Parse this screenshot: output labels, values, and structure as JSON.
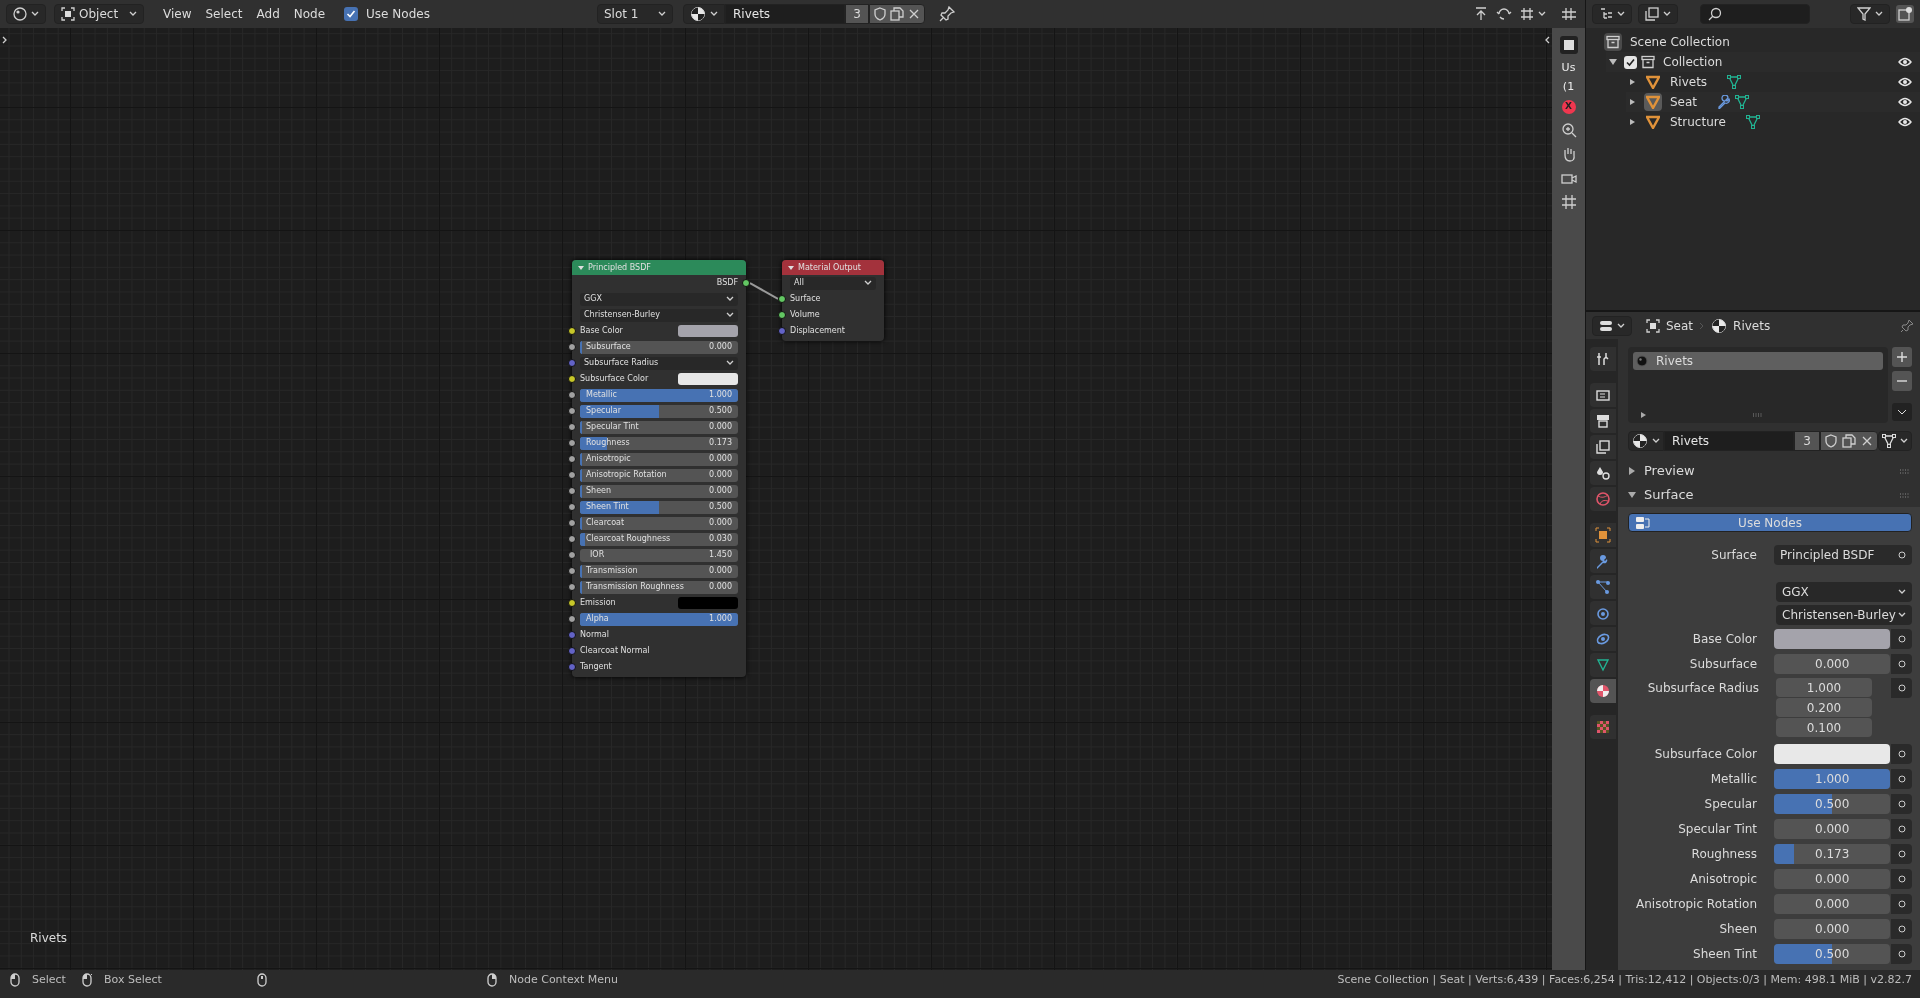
{
  "node_editor": {
    "header": {
      "mode": "Object",
      "menus": [
        "View",
        "Select",
        "Add",
        "Node"
      ],
      "use_nodes": {
        "label": "Use Nodes",
        "checked": true
      },
      "slot": "Slot 1",
      "material": {
        "name": "Rivets",
        "users": "3"
      }
    },
    "nodes": [
      {
        "title": "Principled BSDF",
        "color": "#2c8a5a",
        "expanded": true,
        "rows": [
          {
            "kind": "output",
            "label": "BSDF",
            "socket": {
              "color": "#63c763"
            }
          },
          {
            "kind": "dropdown",
            "value": "GGX"
          },
          {
            "kind": "dropdown",
            "value": "Christensen-Burley"
          },
          {
            "kind": "color",
            "label": "Base Color",
            "color": "#a4a3ab",
            "socket": {
              "color": "#c7c729"
            }
          },
          {
            "kind": "slider",
            "label": "Subsurface",
            "value": "0.000",
            "level": 0,
            "socket": {
              "color": "#a1a1a1"
            }
          },
          {
            "kind": "menu",
            "label": "Subsurface Radius",
            "socket": {
              "color": "#6363c7"
            }
          },
          {
            "kind": "color",
            "label": "Subsurface Color",
            "color": "#e8e8e8",
            "socket": {
              "color": "#c7c729"
            }
          },
          {
            "kind": "slider",
            "label": "Metallic",
            "value": "1.000",
            "level": 1,
            "socket": {
              "color": "#a1a1a1"
            }
          },
          {
            "kind": "slider",
            "label": "Specular",
            "value": "0.500",
            "level": 0.5,
            "socket": {
              "color": "#a1a1a1"
            }
          },
          {
            "kind": "slider",
            "label": "Specular Tint",
            "value": "0.000",
            "level": 0,
            "socket": {
              "color": "#a1a1a1"
            }
          },
          {
            "kind": "slider",
            "label": "Roughness",
            "value": "0.173",
            "level": 0.173,
            "socket": {
              "color": "#a1a1a1"
            }
          },
          {
            "kind": "slider",
            "label": "Anisotropic",
            "value": "0.000",
            "level": 0,
            "socket": {
              "color": "#a1a1a1"
            }
          },
          {
            "kind": "slider",
            "label": "Anisotropic Rotation",
            "value": "0.000",
            "level": 0,
            "socket": {
              "color": "#a1a1a1"
            }
          },
          {
            "kind": "slider",
            "label": "Sheen",
            "value": "0.000",
            "level": 0,
            "socket": {
              "color": "#a1a1a1"
            }
          },
          {
            "kind": "slider",
            "label": "Sheen Tint",
            "value": "0.500",
            "level": 0.5,
            "socket": {
              "color": "#a1a1a1"
            }
          },
          {
            "kind": "slider",
            "label": "Clearcoat",
            "value": "0.000",
            "level": 0,
            "socket": {
              "color": "#a1a1a1"
            }
          },
          {
            "kind": "slider",
            "label": "Clearcoat Roughness",
            "value": "0.030",
            "level": 0.03,
            "socket": {
              "color": "#a1a1a1"
            }
          },
          {
            "kind": "number",
            "label": "IOR",
            "value": "1.450",
            "socket": {
              "color": "#a1a1a1"
            }
          },
          {
            "kind": "slider",
            "label": "Transmission",
            "value": "0.000",
            "level": 0,
            "socket": {
              "color": "#a1a1a1"
            }
          },
          {
            "kind": "slider",
            "label": "Transmission Roughness",
            "value": "0.000",
            "level": 0,
            "socket": {
              "color": "#a1a1a1"
            }
          },
          {
            "kind": "color",
            "label": "Emission",
            "color": "#000000",
            "socket": {
              "color": "#c7c729"
            }
          },
          {
            "kind": "slider",
            "label": "Alpha",
            "value": "1.000",
            "level": 1,
            "socket": {
              "color": "#a1a1a1"
            }
          },
          {
            "kind": "input",
            "label": "Normal",
            "socket": {
              "color": "#6363c7"
            }
          },
          {
            "kind": "input",
            "label": "Clearcoat Normal",
            "socket": {
              "color": "#6363c7"
            }
          },
          {
            "kind": "input",
            "label": "Tangent",
            "socket": {
              "color": "#6363c7"
            }
          }
        ]
      },
      {
        "title": "Material Output",
        "color": "#a3323c",
        "expanded": true,
        "rows": [
          {
            "kind": "dropdown",
            "value": "All"
          },
          {
            "kind": "input",
            "label": "Surface",
            "socket": {
              "color": "#63c763"
            }
          },
          {
            "kind": "input",
            "label": "Volume",
            "socket": {
              "color": "#63c763"
            }
          },
          {
            "kind": "input",
            "label": "Displacement",
            "socket": {
              "color": "#6363c7"
            }
          }
        ]
      }
    ],
    "footer_label": "Rivets"
  },
  "viewport": {
    "overlay_texts": [
      "Us",
      "(1"
    ],
    "axis_label": "X"
  },
  "outliner": {
    "tree": [
      {
        "name": "Scene Collection",
        "kind": "scene_collection",
        "children": [
          {
            "name": "Collection",
            "kind": "collection",
            "checked": true,
            "expanded": true,
            "visible": true,
            "children": [
              {
                "name": "Rivets",
                "kind": "mesh",
                "active": false,
                "modifier": false,
                "visible": true
              },
              {
                "name": "Seat",
                "kind": "mesh",
                "active": true,
                "modifier": true,
                "visible": true
              },
              {
                "name": "Structure",
                "kind": "mesh",
                "active": false,
                "modifier": false,
                "visible": true
              }
            ]
          }
        ]
      }
    ]
  },
  "properties": {
    "object": "Seat",
    "material": "Rivets",
    "tabs": [
      {
        "kind": "tool",
        "selected": false
      },
      {
        "kind": "render",
        "selected": false
      },
      {
        "kind": "output",
        "selected": false
      },
      {
        "kind": "view_layer",
        "selected": false
      },
      {
        "kind": "scene",
        "selected": false
      },
      {
        "kind": "world",
        "selected": false
      },
      {
        "kind": "object",
        "selected": false
      },
      {
        "kind": "modifiers",
        "selected": false
      },
      {
        "kind": "particles",
        "selected": false
      },
      {
        "kind": "physics",
        "selected": false
      },
      {
        "kind": "constraints",
        "selected": false
      },
      {
        "kind": "data",
        "selected": false
      },
      {
        "kind": "material",
        "selected": true
      },
      {
        "kind": "texture",
        "selected": false
      }
    ],
    "slots": [
      {
        "name": "Rivets",
        "selected": true
      }
    ],
    "material_field": {
      "name": "Rivets",
      "users": "3"
    },
    "panels": [
      {
        "title": "Preview",
        "expanded": false
      },
      {
        "title": "Surface",
        "expanded": true
      }
    ],
    "use_nodes": {
      "label": "Use Nodes",
      "on": true
    },
    "surface": {
      "label": "Surface",
      "value": "Principled BSDF"
    },
    "rows": [
      {
        "kind": "dropdown",
        "value": "GGX"
      },
      {
        "kind": "dropdown",
        "value": "Christensen-Burley"
      },
      {
        "kind": "color",
        "label": "Base Color",
        "color": "#a4a3ab"
      },
      {
        "kind": "slider",
        "label": "Subsurface",
        "value": "0.000",
        "level": 0
      },
      {
        "kind": "vector",
        "label": "Subsurface Radius",
        "values": [
          "1.000",
          "0.200",
          "0.100"
        ]
      },
      {
        "kind": "color",
        "label": "Subsurface Color",
        "color": "#e8e8e8"
      },
      {
        "kind": "slider",
        "label": "Metallic",
        "value": "1.000",
        "level": 1
      },
      {
        "kind": "slider",
        "label": "Specular",
        "value": "0.500",
        "level": 0.5
      },
      {
        "kind": "slider",
        "label": "Specular Tint",
        "value": "0.000",
        "level": 0
      },
      {
        "kind": "slider",
        "label": "Roughness",
        "value": "0.173",
        "level": 0.173
      },
      {
        "kind": "slider",
        "label": "Anisotropic",
        "value": "0.000",
        "level": 0
      },
      {
        "kind": "slider",
        "label": "Anisotropic Rotation",
        "value": "0.000",
        "level": 0
      },
      {
        "kind": "slider",
        "label": "Sheen",
        "value": "0.000",
        "level": 0
      },
      {
        "kind": "slider",
        "label": "Sheen Tint",
        "value": "0.500",
        "level": 0.5
      }
    ]
  },
  "status_bar": {
    "hints": [
      {
        "kind": "left",
        "label": "Select"
      },
      {
        "kind": "box",
        "label": "Box Select"
      },
      {
        "kind": "middle"
      },
      {
        "kind": "right",
        "label": "Node Context Menu"
      }
    ],
    "stats": "Scene Collection | Seat | Verts:6,439 | Faces:6,254 | Tris:12,412 | Objects:0/3 | Mem: 498.1 MiB | v2.82.7"
  }
}
